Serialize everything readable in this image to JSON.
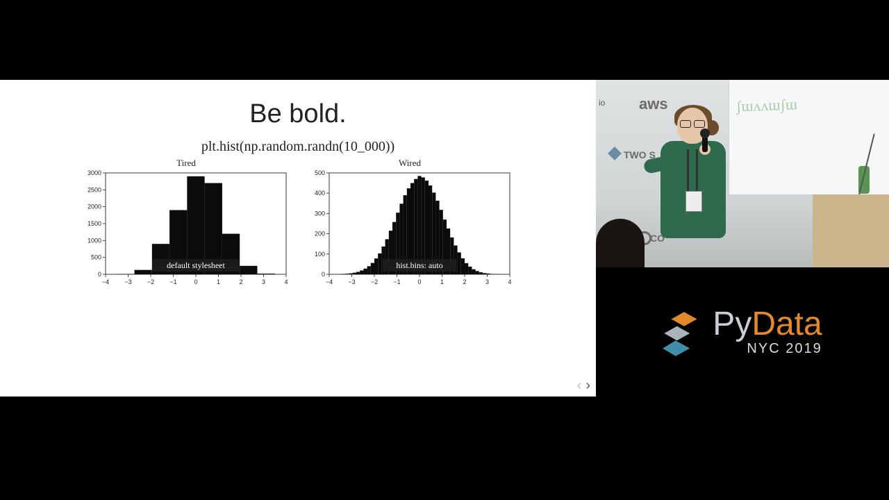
{
  "slide": {
    "title": "Be bold.",
    "code": "plt.hist(np.random.randn(10_000))",
    "nav": {
      "prev": "‹",
      "next": "›"
    }
  },
  "chart_data": [
    {
      "type": "bar",
      "title": "Tired",
      "annotation": "default stylesheet",
      "xlim": [
        -4,
        4
      ],
      "ylim": [
        0,
        3000
      ],
      "bin_edges": [
        -3.5,
        -2.722,
        -1.944,
        -1.167,
        -0.389,
        0.389,
        1.167,
        1.944,
        2.722,
        3.5
      ],
      "values": [
        10,
        130,
        900,
        1900,
        2900,
        2700,
        1200,
        250,
        20
      ],
      "xticks": [
        -4,
        -3,
        -2,
        -1,
        0,
        1,
        2,
        3,
        4
      ],
      "yticks": [
        0,
        500,
        1000,
        1500,
        2000,
        2500,
        3000
      ]
    },
    {
      "type": "bar",
      "title": "Wired",
      "annotation": "hist.bins: auto",
      "xlim": [
        -4,
        4
      ],
      "ylim": [
        0,
        500
      ],
      "bin_edges": [
        -3.6,
        -3.44,
        -3.28,
        -3.12,
        -2.96,
        -2.8,
        -2.64,
        -2.48,
        -2.32,
        -2.16,
        -2.0,
        -1.84,
        -1.68,
        -1.52,
        -1.36,
        -1.2,
        -1.04,
        -0.88,
        -0.72,
        -0.56,
        -0.4,
        -0.24,
        -0.08,
        0.08,
        0.24,
        0.4,
        0.56,
        0.72,
        0.88,
        1.04,
        1.2,
        1.36,
        1.52,
        1.68,
        1.84,
        2.0,
        2.16,
        2.32,
        2.48,
        2.64,
        2.8,
        2.96,
        3.12,
        3.28,
        3.44,
        3.6
      ],
      "values": [
        1,
        2,
        3,
        5,
        8,
        12,
        19,
        28,
        40,
        56,
        78,
        103,
        137,
        173,
        215,
        258,
        304,
        348,
        390,
        424,
        450,
        470,
        485,
        478,
        462,
        438,
        403,
        363,
        318,
        270,
        226,
        182,
        142,
        108,
        79,
        55,
        38,
        25,
        16,
        10,
        6,
        4,
        2,
        1,
        1
      ],
      "xticks": [
        -4,
        -3,
        -2,
        -1,
        0,
        1,
        2,
        3,
        4
      ],
      "yticks": [
        0,
        100,
        200,
        300,
        400,
        500
      ]
    }
  ],
  "speaker_pane": {
    "labels": {
      "io": "io",
      "aws": "aws",
      "two_sigma": "TWO S",
      "co": "CO"
    },
    "scribble": "ʃɯʌʌɯʃɯ"
  },
  "branding": {
    "py": "Py",
    "data": "Data",
    "subtitle": "NYC 2019"
  }
}
